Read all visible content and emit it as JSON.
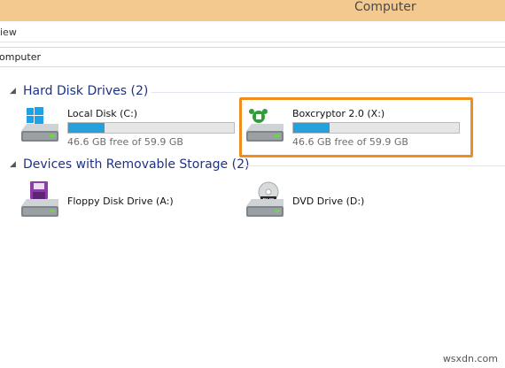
{
  "window": {
    "title": "Computer"
  },
  "ribbon": {
    "tab_label": "iew"
  },
  "address": {
    "path": "omputer"
  },
  "groups": [
    {
      "title": "Hard Disk Drives (2)",
      "drives": [
        {
          "name": "Local Disk (C:)",
          "free_text": "46.6 GB free of 59.9 GB",
          "used_fraction": 0.22,
          "icon": "windows-drive-icon"
        },
        {
          "name": "Boxcryptor 2.0 (X:)",
          "free_text": "46.6 GB free of 59.9 GB",
          "used_fraction": 0.22,
          "icon": "boxcryptor-drive-icon",
          "highlighted": true
        }
      ]
    },
    {
      "title": "Devices with Removable Storage (2)",
      "drives": [
        {
          "name": "Floppy Disk Drive (A:)",
          "icon": "floppy-drive-icon"
        },
        {
          "name": "DVD Drive (D:)",
          "icon": "dvd-drive-icon"
        }
      ]
    }
  ],
  "watermark": "wsxdn.com",
  "colors": {
    "titlebar": "#f3c98f",
    "group_title": "#1e3287",
    "bar_fill": "#26a0da",
    "highlight": "#f08e1b"
  }
}
